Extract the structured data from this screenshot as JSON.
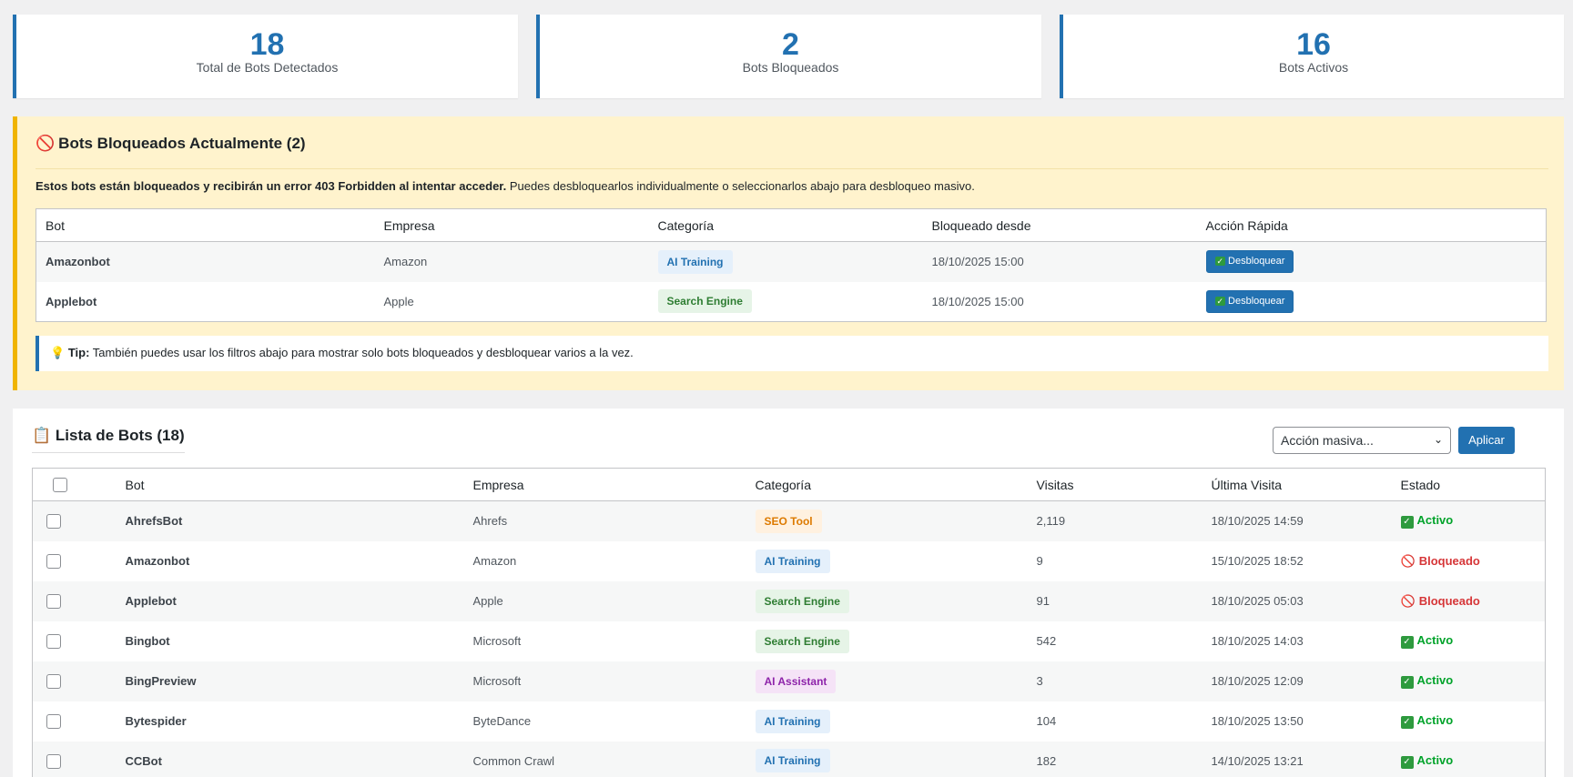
{
  "stats": [
    {
      "value": "18",
      "label": "Total de Bots Detectados"
    },
    {
      "value": "2",
      "label": "Bots Bloqueados"
    },
    {
      "value": "16",
      "label": "Bots Activos"
    }
  ],
  "blocked": {
    "icon": "prohibited-icon",
    "title": "Bots Bloqueados Actualmente (2)",
    "desc_bold": "Estos bots están bloqueados y recibirán un error 403 Forbidden al intentar acceder.",
    "desc_rest": " Puedes desbloquearlos individualmente o seleccionarlos abajo para desbloqueo masivo.",
    "headers": [
      "Bot",
      "Empresa",
      "Categoría",
      "Bloqueado desde",
      "Acción Rápida"
    ],
    "rows": [
      {
        "bot": "Amazonbot",
        "empresa": "Amazon",
        "categoria": "AI Training",
        "desde": "18/10/2025 15:00",
        "accion": "Desbloquear"
      },
      {
        "bot": "Applebot",
        "empresa": "Apple",
        "categoria": "Search Engine",
        "desde": "18/10/2025 15:00",
        "accion": "Desbloquear"
      }
    ],
    "tip_icon": "lightbulb-icon",
    "tip_label": "Tip:",
    "tip_text": " También puedes usar los filtros abajo para mostrar solo bots bloqueados y desbloquear varios a la vez."
  },
  "list": {
    "icon": "clipboard-icon",
    "title": "Lista de Bots (18)",
    "bulk_select": "Acción masiva...",
    "apply": "Aplicar",
    "headers": [
      "Bot",
      "Empresa",
      "Categoría",
      "Visitas",
      "Última Visita",
      "Estado"
    ],
    "rows": [
      {
        "bot": "AhrefsBot",
        "empresa": "Ahrefs",
        "categoria": "SEO Tool",
        "visitas": "2,119",
        "ultima": "18/10/2025 14:59",
        "estado": "Activo"
      },
      {
        "bot": "Amazonbot",
        "empresa": "Amazon",
        "categoria": "AI Training",
        "visitas": "9",
        "ultima": "15/10/2025 18:52",
        "estado": "Bloqueado"
      },
      {
        "bot": "Applebot",
        "empresa": "Apple",
        "categoria": "Search Engine",
        "visitas": "91",
        "ultima": "18/10/2025 05:03",
        "estado": "Bloqueado"
      },
      {
        "bot": "Bingbot",
        "empresa": "Microsoft",
        "categoria": "Search Engine",
        "visitas": "542",
        "ultima": "18/10/2025 14:03",
        "estado": "Activo"
      },
      {
        "bot": "BingPreview",
        "empresa": "Microsoft",
        "categoria": "AI Assistant",
        "visitas": "3",
        "ultima": "18/10/2025 12:09",
        "estado": "Activo"
      },
      {
        "bot": "Bytespider",
        "empresa": "ByteDance",
        "categoria": "AI Training",
        "visitas": "104",
        "ultima": "18/10/2025 13:50",
        "estado": "Activo"
      },
      {
        "bot": "CCBot",
        "empresa": "Common Crawl",
        "categoria": "AI Training",
        "visitas": "182",
        "ultima": "14/10/2025 13:21",
        "estado": "Activo"
      }
    ]
  },
  "colors": {
    "accent": "#2271b1",
    "warning_bg": "#fff3cd",
    "warning_border": "#f0b400",
    "active": "#00a32a",
    "blocked": "#d63638"
  }
}
